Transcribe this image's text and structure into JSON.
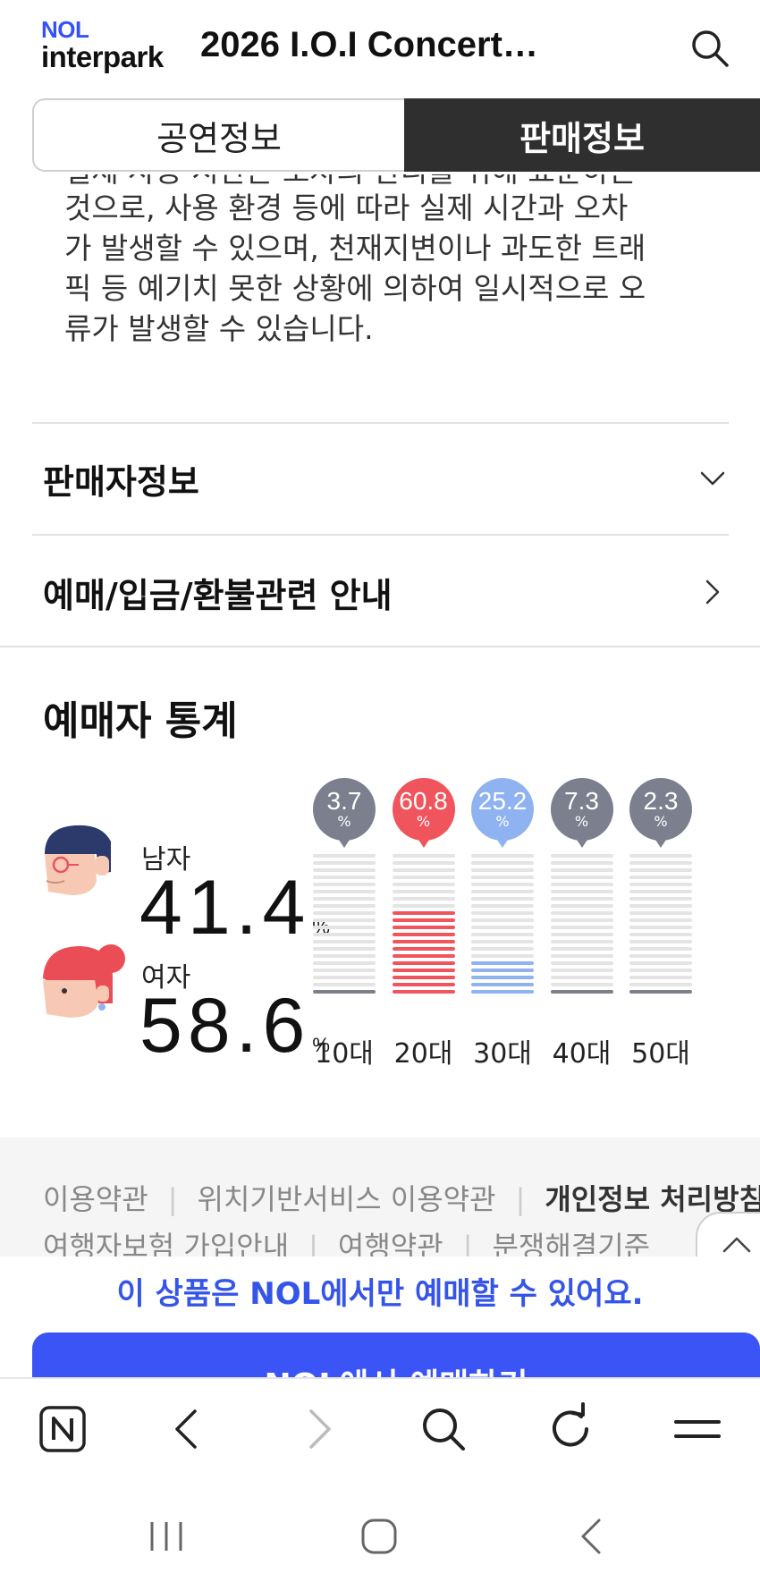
{
  "header": {
    "logo_top": "NOL",
    "logo_bottom": "interpark",
    "title": "2026 I.O.I Concert…"
  },
  "tabs": [
    {
      "label": "공연정보",
      "active": false
    },
    {
      "label": "판매정보",
      "active": true
    }
  ],
  "notice": {
    "clipped_line": "실제 사용 시간은 오차의 관리를 위해 표준하는",
    "lines": [
      "것으로, 사용 환경 등에 따라 실제 시간과 오차",
      "가 발생할 수 있으며, 천재지변이나 과도한 트래",
      "픽 등 예기치 못한 상황에 의하여 일시적으로 오",
      "류가 발생할 수 있습니다."
    ]
  },
  "sections": {
    "seller_info": "판매자정보",
    "booking_refund": "예매/입금/환불관련 안내"
  },
  "stats": {
    "title": "예매자 통계",
    "male_label": "남자",
    "male_value": "41.4",
    "female_label": "여자",
    "female_value": "58.6",
    "percent_sign": "%",
    "age_groups": [
      {
        "label": "10대",
        "value": "3.7",
        "level": 0.037,
        "color": "#7b7f8e"
      },
      {
        "label": "20대",
        "value": "60.8",
        "level": 0.608,
        "color": "#f0545d"
      },
      {
        "label": "30대",
        "value": "25.2",
        "level": 0.252,
        "color": "#8fb3f0"
      },
      {
        "label": "40대",
        "value": "7.3",
        "level": 0.073,
        "color": "#7b7f8e"
      },
      {
        "label": "50대",
        "value": "2.3",
        "level": 0.023,
        "color": "#7b7f8e"
      }
    ]
  },
  "footer": {
    "row1": [
      "이용약관",
      "위치기반서비스 이용약관",
      "개인정보 처리방침"
    ],
    "row2": [
      "여행자보험 가입안내",
      "여행약관",
      "분쟁해결기준"
    ]
  },
  "notice_nol_only": "이 상품은 NOL에서만 예매할 수 있어요.",
  "buy_button": "NOL에서 예매하기",
  "colors": {
    "brand": "#3a54f5",
    "tab_active_bg": "#2f2f2f",
    "bar_empty": "#e4e4e4"
  },
  "icons": {
    "browser": [
      "n-home-icon",
      "back-icon",
      "forward-icon",
      "search-icon",
      "refresh-icon",
      "menu-icon"
    ],
    "system": [
      "recent-apps-icon",
      "home-icon",
      "back-nav-icon"
    ]
  }
}
